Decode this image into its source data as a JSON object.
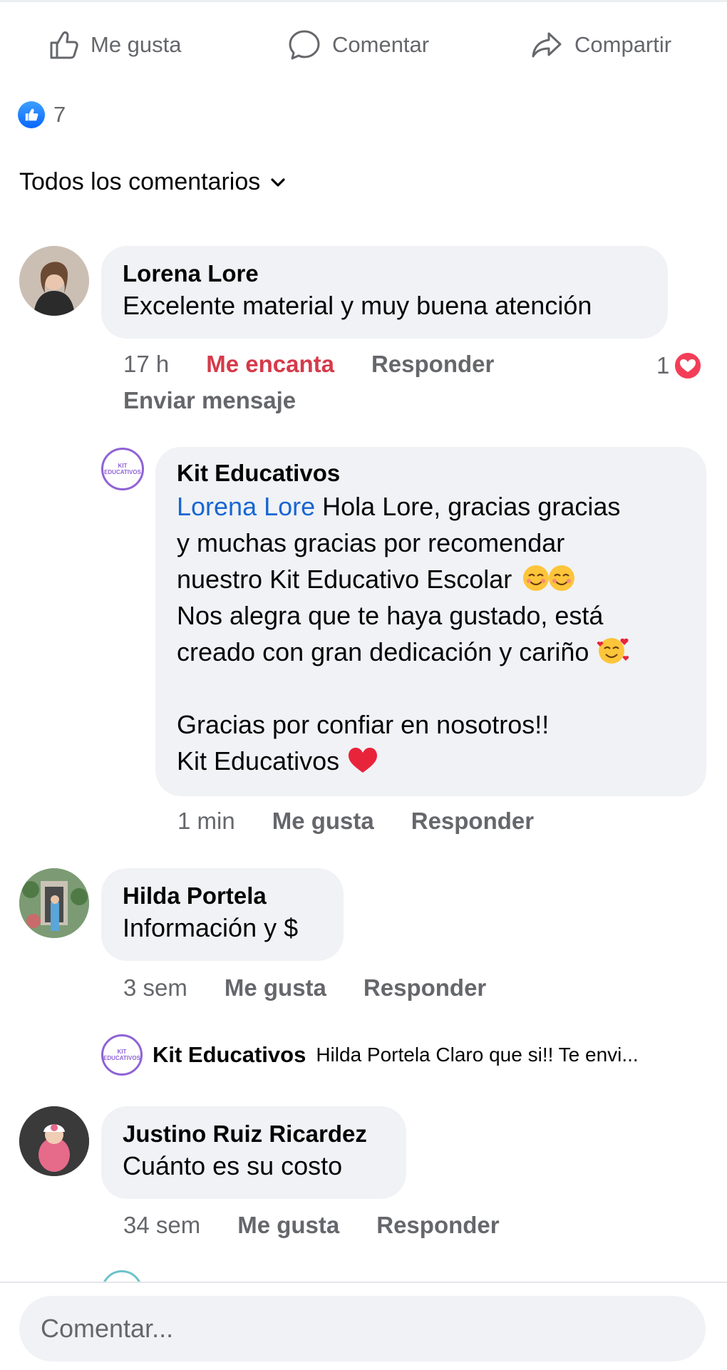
{
  "actions": {
    "like_label": "Me gusta",
    "comment_label": "Comentar",
    "share_label": "Compartir"
  },
  "reactions": {
    "count": "7"
  },
  "filter": {
    "label": "Todos los comentarios"
  },
  "comments": [
    {
      "author": "Lorena Lore",
      "text": "Excelente material y muy buena atención",
      "time": "17 h",
      "reaction_label": "Me encanta",
      "reply_label": "Responder",
      "send_message_label": "Enviar mensaje",
      "reaction_count": "1",
      "reply": {
        "author": "Kit Educativos",
        "mention": "Lorena Lore",
        "line1": " Hola Lore, gracias gracias",
        "line2": "y muchas gracias por recomendar",
        "line3": "nuestro Kit Educativo Escolar",
        "line4": "Nos alegra que te haya gustado, está",
        "line5": "creado con gran dedicación y cariño",
        "line6": "Gracias por confiar en nosotros!!",
        "line7": "Kit Educativos",
        "time": "1 min",
        "like_label": "Me gusta",
        "reply_label": "Responder"
      }
    },
    {
      "author": "Hilda Portela",
      "text": "Información y $",
      "time": "3 sem",
      "like_label": "Me gusta",
      "reply_label": "Responder",
      "reply_preview": {
        "author": "Kit Educativos",
        "text": "Hilda Portela Claro que si!! Te envi..."
      }
    },
    {
      "author": "Justino Ruiz Ricardez",
      "text": "Cuánto es su costo",
      "time": "34 sem",
      "like_label": "Me gusta",
      "reply_label": "Responder"
    }
  ],
  "brand_logo_text": "KIT EDUCATIVOS",
  "composer": {
    "placeholder": "Comentar..."
  }
}
